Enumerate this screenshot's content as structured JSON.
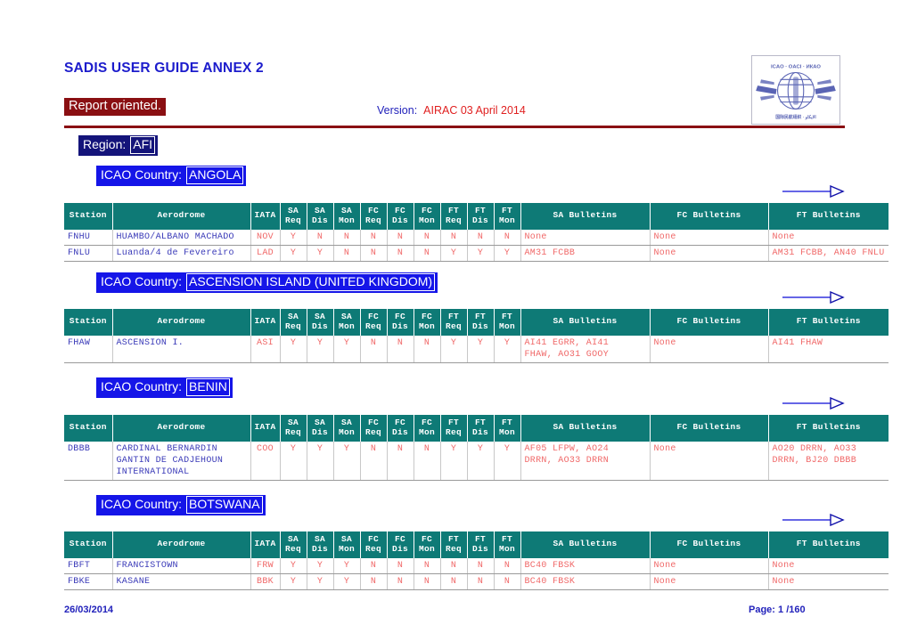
{
  "header": {
    "title": "SADIS USER GUIDE ANNEX 2",
    "report_mode": "Report oriented.",
    "version_label": "Version:",
    "version_value": "AIRAC 03 April 2014",
    "logo_name": "ICAO",
    "logo_text_top": "ICAO · OACI · ИКАО",
    "rule_color": "#8a0f12"
  },
  "region": {
    "label": "Region:",
    "value": "AFI",
    "banner_color": "#14147a"
  },
  "country_banner_color": "#1515e8",
  "table_header_color": "#0e7a76",
  "columns": [
    {
      "key": "station",
      "label": "Station",
      "sub": ""
    },
    {
      "key": "aerodrome",
      "label": "Aerodrome",
      "sub": ""
    },
    {
      "key": "iata",
      "label": "IATA",
      "sub": ""
    },
    {
      "key": "sa_req",
      "label": "SA",
      "sub": "Req"
    },
    {
      "key": "sa_dis",
      "label": "SA",
      "sub": "Dis"
    },
    {
      "key": "sa_mon",
      "label": "SA",
      "sub": "Mon"
    },
    {
      "key": "fc_req",
      "label": "FC",
      "sub": "Req"
    },
    {
      "key": "fc_dis",
      "label": "FC",
      "sub": "Dis"
    },
    {
      "key": "fc_mon",
      "label": "FC",
      "sub": "Mon"
    },
    {
      "key": "ft_req",
      "label": "FT",
      "sub": "Req"
    },
    {
      "key": "ft_dis",
      "label": "FT",
      "sub": "Dis"
    },
    {
      "key": "ft_mon",
      "label": "FT",
      "sub": "Mon"
    },
    {
      "key": "sa_bull",
      "label": "SA Bulletins",
      "sub": ""
    },
    {
      "key": "fc_bull",
      "label": "FC Bulletins",
      "sub": ""
    },
    {
      "key": "ft_bull",
      "label": "FT Bulletins",
      "sub": ""
    }
  ],
  "countries": [
    {
      "label": "ICAO Country:",
      "name": "ANGOLA",
      "rows": [
        {
          "station": "FNHU",
          "aerodrome": "HUAMBO/ALBANO MACHADO",
          "iata": "NOV",
          "sa_req": "Y",
          "sa_dis": "N",
          "sa_mon": "N",
          "fc_req": "N",
          "fc_dis": "N",
          "fc_mon": "N",
          "ft_req": "N",
          "ft_dis": "N",
          "ft_mon": "N",
          "sa_bull": "None",
          "fc_bull": "None",
          "ft_bull": "None"
        },
        {
          "station": "FNLU",
          "aerodrome": "Luanda/4 de Fevereiro",
          "iata": "LAD",
          "sa_req": "Y",
          "sa_dis": "Y",
          "sa_mon": "N",
          "fc_req": "N",
          "fc_dis": "N",
          "fc_mon": "N",
          "ft_req": "Y",
          "ft_dis": "Y",
          "ft_mon": "Y",
          "sa_bull": "AM31 FCBB",
          "fc_bull": "None",
          "ft_bull": "AM31 FCBB, AN40 FNLU"
        }
      ]
    },
    {
      "label": "ICAO Country:",
      "name": "ASCENSION ISLAND (UNITED KINGDOM)",
      "rows": [
        {
          "station": "FHAW",
          "aerodrome": "ASCENSION I.",
          "iata": "ASI",
          "sa_req": "Y",
          "sa_dis": "Y",
          "sa_mon": "Y",
          "fc_req": "N",
          "fc_dis": "N",
          "fc_mon": "N",
          "ft_req": "Y",
          "ft_dis": "Y",
          "ft_mon": "Y",
          "sa_bull": "AI41 EGRR, AI41\nFHAW, AO31 GOOY",
          "fc_bull": "None",
          "ft_bull": "AI41 FHAW"
        }
      ]
    },
    {
      "label": "ICAO Country:",
      "name": "BENIN",
      "rows": [
        {
          "station": "DBBB",
          "aerodrome": "CARDINAL BERNARDIN\nGANTIN DE CADJEHOUN\nINTERNATIONAL",
          "iata": "COO",
          "sa_req": "Y",
          "sa_dis": "Y",
          "sa_mon": "Y",
          "fc_req": "N",
          "fc_dis": "N",
          "fc_mon": "N",
          "ft_req": "Y",
          "ft_dis": "Y",
          "ft_mon": "Y",
          "sa_bull": "AF05 LFPW, AO24\nDRRN, AO33 DRRN",
          "fc_bull": "None",
          "ft_bull": "AO20 DRRN, AO33\nDRRN, BJ20 DBBB"
        }
      ]
    },
    {
      "label": "ICAO Country:",
      "name": "BOTSWANA",
      "rows": [
        {
          "station": "FBFT",
          "aerodrome": "FRANCISTOWN",
          "iata": "FRW",
          "sa_req": "Y",
          "sa_dis": "Y",
          "sa_mon": "Y",
          "fc_req": "N",
          "fc_dis": "N",
          "fc_mon": "N",
          "ft_req": "N",
          "ft_dis": "N",
          "ft_mon": "N",
          "sa_bull": "BC40 FBSK",
          "fc_bull": "None",
          "ft_bull": "None"
        },
        {
          "station": "FBKE",
          "aerodrome": "KASANE",
          "iata": "BBK",
          "sa_req": "Y",
          "sa_dis": "Y",
          "sa_mon": "Y",
          "fc_req": "N",
          "fc_dis": "N",
          "fc_mon": "N",
          "ft_req": "N",
          "ft_dis": "N",
          "ft_mon": "N",
          "sa_bull": "BC40 FBSK",
          "fc_bull": "None",
          "ft_bull": "None"
        }
      ]
    }
  ],
  "footer": {
    "date": "26/03/2014",
    "page_label": "Page:",
    "page_current": "1",
    "page_separator": "/",
    "page_total": "160"
  }
}
